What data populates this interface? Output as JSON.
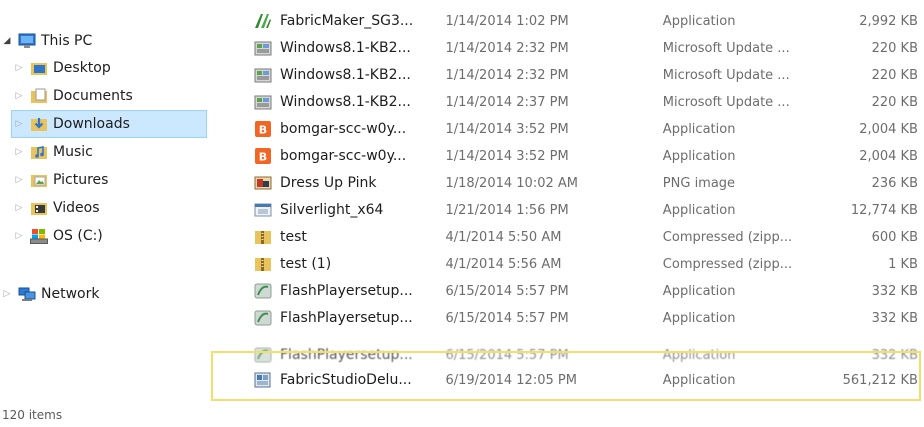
{
  "navigation": {
    "items": [
      {
        "label": "This PC",
        "icon": "pc-icon"
      },
      {
        "label": "Desktop",
        "icon": "desktop-folder-icon"
      },
      {
        "label": "Documents",
        "icon": "documents-folder-icon"
      },
      {
        "label": "Downloads",
        "icon": "downloads-folder-icon",
        "selected": true
      },
      {
        "label": "Music",
        "icon": "music-folder-icon"
      },
      {
        "label": "Pictures",
        "icon": "pictures-folder-icon"
      },
      {
        "label": "Videos",
        "icon": "videos-folder-icon"
      },
      {
        "label": "OS (C:)",
        "icon": "drive-icon"
      },
      {
        "label": "Network",
        "icon": "network-icon"
      }
    ],
    "expander_open": "◢",
    "expander_closed": "▷"
  },
  "files": [
    {
      "name": "FabricMaker_SG3...",
      "date": "1/14/2014 1:02 PM",
      "type": "Application",
      "size": "2,992 KB",
      "icon": "fabricmaker-app-icon"
    },
    {
      "name": "Windows8.1-KB2...",
      "date": "1/14/2014 2:32 PM",
      "type": "Microsoft Update ...",
      "size": "220 KB",
      "icon": "update-package-icon"
    },
    {
      "name": "Windows8.1-KB2...",
      "date": "1/14/2014 2:32 PM",
      "type": "Microsoft Update ...",
      "size": "220 KB",
      "icon": "update-package-icon"
    },
    {
      "name": "Windows8.1-KB2...",
      "date": "1/14/2014 2:37 PM",
      "type": "Microsoft Update ...",
      "size": "220 KB",
      "icon": "update-package-icon"
    },
    {
      "name": "bomgar-scc-w0y...",
      "date": "1/14/2014 3:52 PM",
      "type": "Application",
      "size": "2,004 KB",
      "icon": "bomgar-app-icon"
    },
    {
      "name": "bomgar-scc-w0y...",
      "date": "1/14/2014 3:52 PM",
      "type": "Application",
      "size": "2,004 KB",
      "icon": "bomgar-app-icon"
    },
    {
      "name": "Dress Up Pink",
      "date": "1/18/2014 10:02 AM",
      "type": "PNG image",
      "size": "236 KB",
      "icon": "png-image-icon"
    },
    {
      "name": "Silverlight_x64",
      "date": "1/21/2014 1:56 PM",
      "type": "Application",
      "size": "12,774 KB",
      "icon": "installer-icon"
    },
    {
      "name": "test",
      "date": "4/1/2014 5:50 AM",
      "type": "Compressed (zipp...",
      "size": "600 KB",
      "icon": "zip-folder-icon"
    },
    {
      "name": "test (1)",
      "date": "4/1/2014 5:56 AM",
      "type": "Compressed (zipp...",
      "size": "1 KB",
      "icon": "zip-folder-icon"
    },
    {
      "name": "FlashPlayersetup...",
      "date": "6/15/2014 5:57 PM",
      "type": "Application",
      "size": "332 KB",
      "icon": "flash-setup-icon"
    },
    {
      "name": "FlashPlayersetup...",
      "date": "6/15/2014 5:57 PM",
      "type": "Application",
      "size": "332 KB",
      "icon": "flash-setup-icon"
    },
    {
      "name": "FlashPlayersetup...",
      "date": "6/15/2014 5:57 PM",
      "type": "Application",
      "size": "332 KB",
      "icon": "flash-setup-icon"
    },
    {
      "name": "FabricStudioDelu...",
      "date": "6/19/2014 12:05 PM",
      "type": "Application",
      "size": "561,212 KB",
      "icon": "fabricstudio-app-icon"
    }
  ],
  "status": {
    "item_count": "120 items"
  },
  "colors": {
    "selection_bg": "#cce8ff",
    "selection_border": "#99d1ff",
    "highlight_box": "#f3e06a",
    "secondary_text": "#6d6d6d"
  }
}
